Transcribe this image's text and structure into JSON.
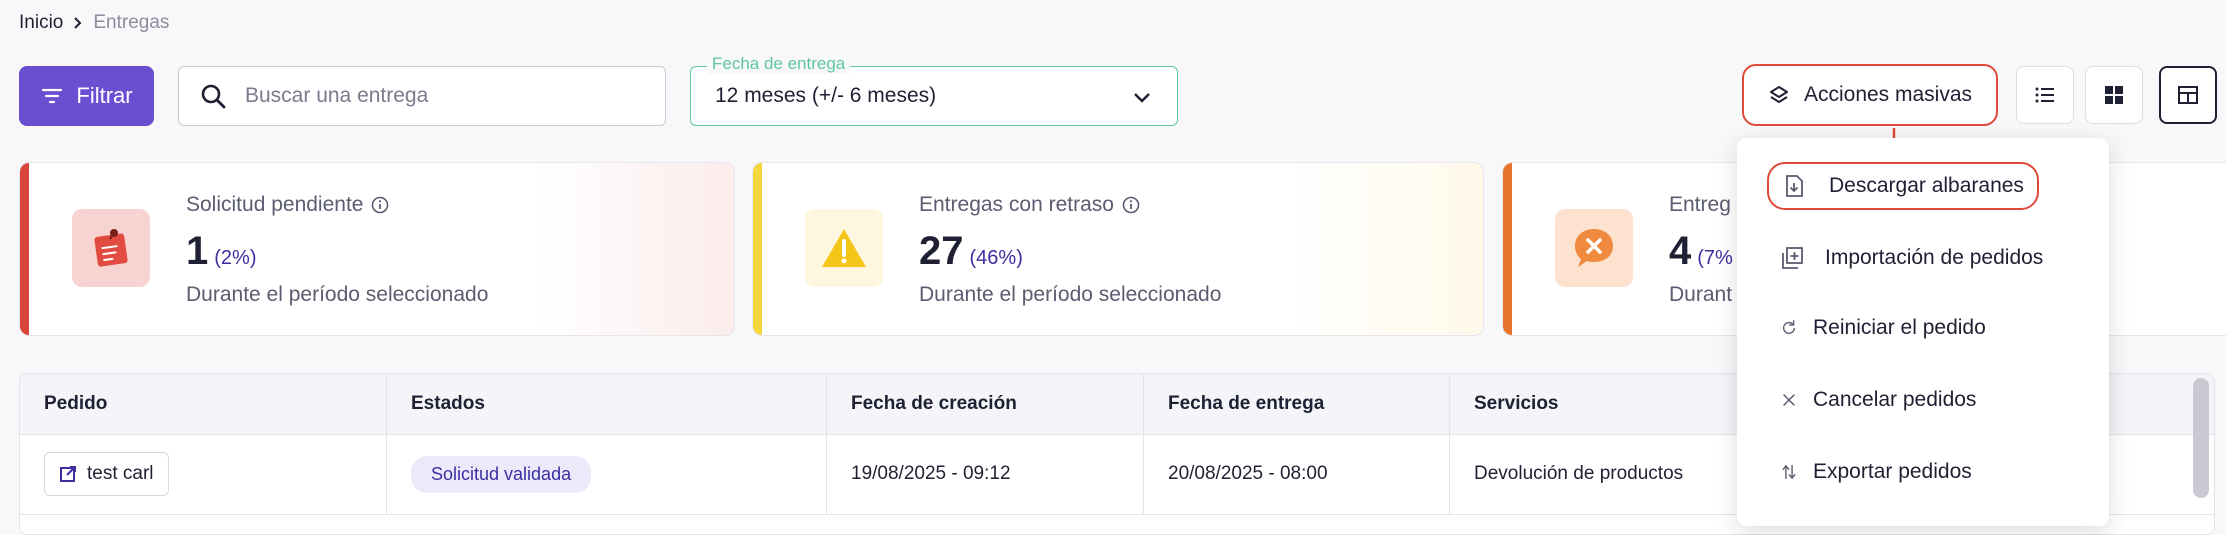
{
  "breadcrumb": {
    "home": "Inicio",
    "current": "Entregas"
  },
  "toolbar": {
    "filter_label": "Filtrar",
    "search_placeholder": "Buscar una entrega",
    "date_label": "Fecha de entrega",
    "date_value": "12 meses (+/- 6 meses)",
    "bulk_label": "Acciones masivas"
  },
  "cards": [
    {
      "title": "Solicitud pendiente",
      "value": "1",
      "percent": "(2%)",
      "subtitle": "Durante el período seleccionado",
      "accent": "#d9453a"
    },
    {
      "title": "Entregas con retraso",
      "value": "27",
      "percent": "(46%)",
      "subtitle": "Durante el período seleccionado",
      "accent": "#f5d63d"
    },
    {
      "title": "Entreg",
      "value": "4",
      "percent": "(7%",
      "subtitle": "Durant",
      "accent": "#e8742c"
    }
  ],
  "table": {
    "headers": [
      "Pedido",
      "Estados",
      "Fecha de creación",
      "Fecha de entrega",
      "Servicios"
    ],
    "rows": [
      {
        "order": "test carl",
        "status": "Solicitud validada",
        "created": "19/08/2025 - 09:12",
        "delivery": "20/08/2025 - 08:00",
        "services": "Devolución de productos"
      }
    ]
  },
  "menu": {
    "items": [
      {
        "label": "Descargar albaranes",
        "icon": "download-doc-icon"
      },
      {
        "label": "Importación de pedidos",
        "icon": "import-icon"
      },
      {
        "label": "Reiniciar el pedido",
        "icon": "refresh-icon"
      },
      {
        "label": "Cancelar pedidos",
        "icon": "close-icon"
      },
      {
        "label": "Exportar pedidos",
        "icon": "export-icon"
      }
    ]
  },
  "colors": {
    "primary": "#6a4fd0",
    "highlight": "#e04a3a",
    "date_border": "#5fc79b"
  }
}
